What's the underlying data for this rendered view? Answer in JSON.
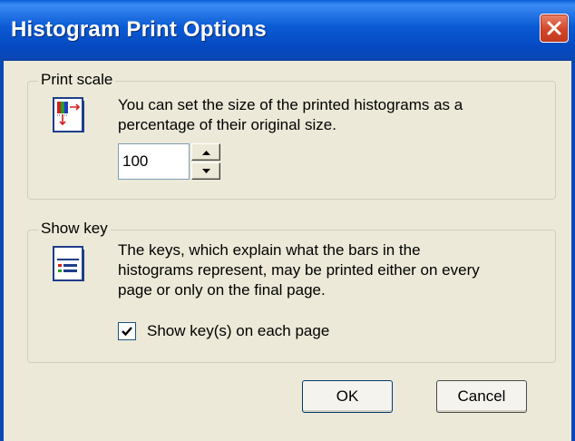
{
  "window": {
    "title": "Histogram Print Options"
  },
  "print_scale": {
    "group_label": "Print scale",
    "description_line1": "You can set the size of the printed histograms as a",
    "description_line2": "percentage of their original size.",
    "scale_value": "100",
    "icon": "print-scale-icon"
  },
  "show_key": {
    "group_label": "Show key",
    "description_line1": "The keys, which explain what the bars in the",
    "description_line2": "histograms represent, may be printed either on every",
    "description_line3": "page or only on the final page.",
    "checkbox_label": "Show key(s) on each page",
    "checkbox_checked": true,
    "icon": "key-legend-icon"
  },
  "buttons": {
    "ok_label": "OK",
    "cancel_label": "Cancel"
  },
  "colors": {
    "titlebar": "#0a5ad4",
    "close_button": "#d4452a",
    "dialog_face": "#ece9d8"
  }
}
